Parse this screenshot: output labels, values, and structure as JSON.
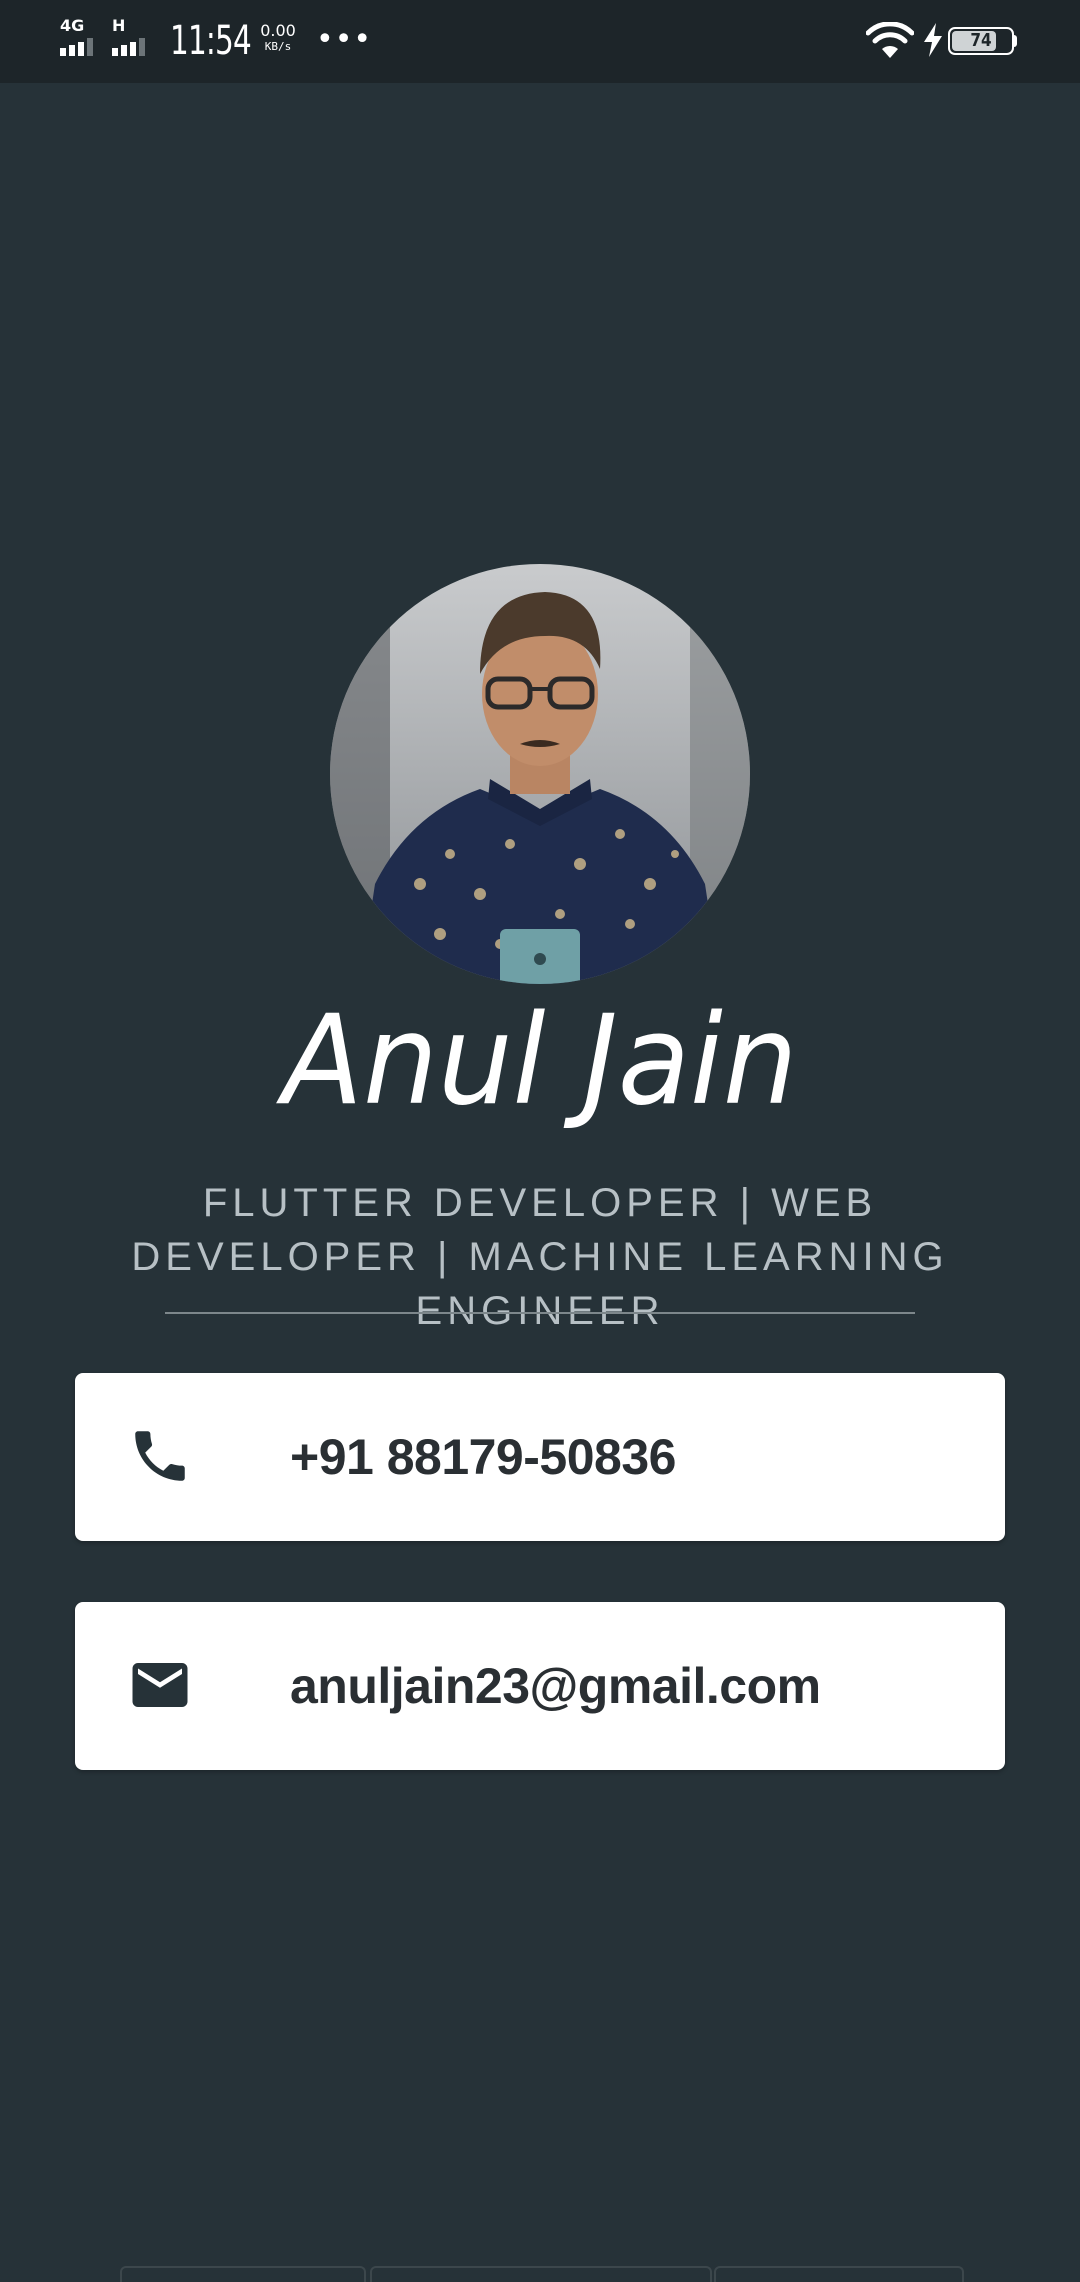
{
  "status_bar": {
    "network_primary": "4G",
    "network_secondary": "H",
    "time": "11:54",
    "speed_value": "0.00",
    "speed_unit": "KB/s",
    "more": "•••",
    "battery_level": "74",
    "battery_fraction": 0.74,
    "icons": [
      "signal-icon",
      "wifi-icon",
      "charging-bolt-icon",
      "battery-icon"
    ]
  },
  "profile": {
    "name": "Anul Jain",
    "title": "FLUTTER DEVELOPER | WEB DEVELOPER | MACHINE LEARNING ENGINEER"
  },
  "contacts": {
    "phone": {
      "icon": "phone-icon",
      "value": "+91 88179-50836"
    },
    "email": {
      "icon": "mail-icon",
      "value": "anuljain23@gmail.com"
    }
  },
  "colors": {
    "background": "#263238",
    "status_bar": "#1d2529",
    "card": "#ffffff",
    "card_text": "#2a2f33",
    "subtitle": "#b7c0c5"
  }
}
